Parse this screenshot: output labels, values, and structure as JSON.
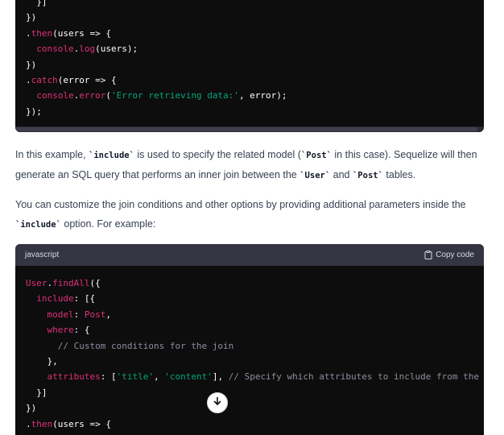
{
  "code_block_1": {
    "lines": [
      [
        {
          "t": "  }]",
          "c": "white"
        }
      ],
      [
        {
          "t": "})",
          "c": "white"
        }
      ],
      [
        {
          "t": ".",
          "c": "white"
        },
        {
          "t": "then",
          "c": "red"
        },
        {
          "t": "(users => {",
          "c": "white"
        }
      ],
      [
        {
          "t": "  ",
          "c": "white"
        },
        {
          "t": "console",
          "c": "red"
        },
        {
          "t": ".",
          "c": "white"
        },
        {
          "t": "log",
          "c": "red"
        },
        {
          "t": "(users);",
          "c": "white"
        }
      ],
      [
        {
          "t": "})",
          "c": "white"
        }
      ],
      [
        {
          "t": ".",
          "c": "white"
        },
        {
          "t": "catch",
          "c": "red"
        },
        {
          "t": "(error => {",
          "c": "white"
        }
      ],
      [
        {
          "t": "  ",
          "c": "white"
        },
        {
          "t": "console",
          "c": "red"
        },
        {
          "t": ".",
          "c": "white"
        },
        {
          "t": "error",
          "c": "red"
        },
        {
          "t": "(",
          "c": "white"
        },
        {
          "t": "'Error retrieving data:'",
          "c": "green"
        },
        {
          "t": ", error);",
          "c": "white"
        }
      ],
      [
        {
          "t": "});",
          "c": "white"
        }
      ]
    ]
  },
  "paragraph_1": {
    "parts": [
      {
        "t": "In this example, ",
        "code": false
      },
      {
        "t": "`include`",
        "code": true
      },
      {
        "t": " is used to specify the related model (",
        "code": false
      },
      {
        "t": "`Post`",
        "code": true
      },
      {
        "t": " in this case). Sequelize will then generate an SQL query that performs an inner join between the ",
        "code": false
      },
      {
        "t": "`User`",
        "code": true
      },
      {
        "t": " and ",
        "code": false
      },
      {
        "t": "`Post`",
        "code": true
      },
      {
        "t": " tables.",
        "code": false
      }
    ]
  },
  "paragraph_2": {
    "parts": [
      {
        "t": "You can customize the join conditions and other options by providing additional parameters inside the ",
        "code": false
      },
      {
        "t": "`include`",
        "code": true
      },
      {
        "t": " option. For example:",
        "code": false
      }
    ]
  },
  "code_block_2": {
    "language": "javascript",
    "copy_label": "Copy code",
    "lines": [
      [
        {
          "t": "User",
          "c": "red"
        },
        {
          "t": ".",
          "c": "white"
        },
        {
          "t": "findAll",
          "c": "red"
        },
        {
          "t": "({",
          "c": "white"
        }
      ],
      [
        {
          "t": "  ",
          "c": "white"
        },
        {
          "t": "include",
          "c": "red"
        },
        {
          "t": ": [{",
          "c": "white"
        }
      ],
      [
        {
          "t": "    ",
          "c": "white"
        },
        {
          "t": "model",
          "c": "red"
        },
        {
          "t": ": ",
          "c": "white"
        },
        {
          "t": "Post",
          "c": "red"
        },
        {
          "t": ",",
          "c": "white"
        }
      ],
      [
        {
          "t": "    ",
          "c": "white"
        },
        {
          "t": "where",
          "c": "red"
        },
        {
          "t": ": {",
          "c": "white"
        }
      ],
      [
        {
          "t": "      ",
          "c": "white"
        },
        {
          "t": "// Custom conditions for the join",
          "c": "gray"
        }
      ],
      [
        {
          "t": "    },",
          "c": "white"
        }
      ],
      [
        {
          "t": "    ",
          "c": "white"
        },
        {
          "t": "attributes",
          "c": "red"
        },
        {
          "t": ": [",
          "c": "white"
        },
        {
          "t": "'title'",
          "c": "green"
        },
        {
          "t": ", ",
          "c": "white"
        },
        {
          "t": "'content'",
          "c": "green"
        },
        {
          "t": "], ",
          "c": "white"
        },
        {
          "t": "// Specify which attributes to include from the",
          "c": "gray"
        }
      ],
      [
        {
          "t": "  }]",
          "c": "white"
        }
      ],
      [
        {
          "t": "})",
          "c": "white"
        }
      ],
      [
        {
          "t": ".",
          "c": "white"
        },
        {
          "t": "then",
          "c": "red"
        },
        {
          "t": "(users => {",
          "c": "white"
        }
      ]
    ]
  },
  "icons": {
    "copy": "clipboard-icon",
    "scroll_down": "arrow-down-icon"
  },
  "colors": {
    "code_bg": "#0d0d0d",
    "code_header_bg": "#343541",
    "keyword": "#df3079",
    "string": "#00a67d",
    "comment": "#8e8ea0",
    "body_text": "#374151"
  }
}
